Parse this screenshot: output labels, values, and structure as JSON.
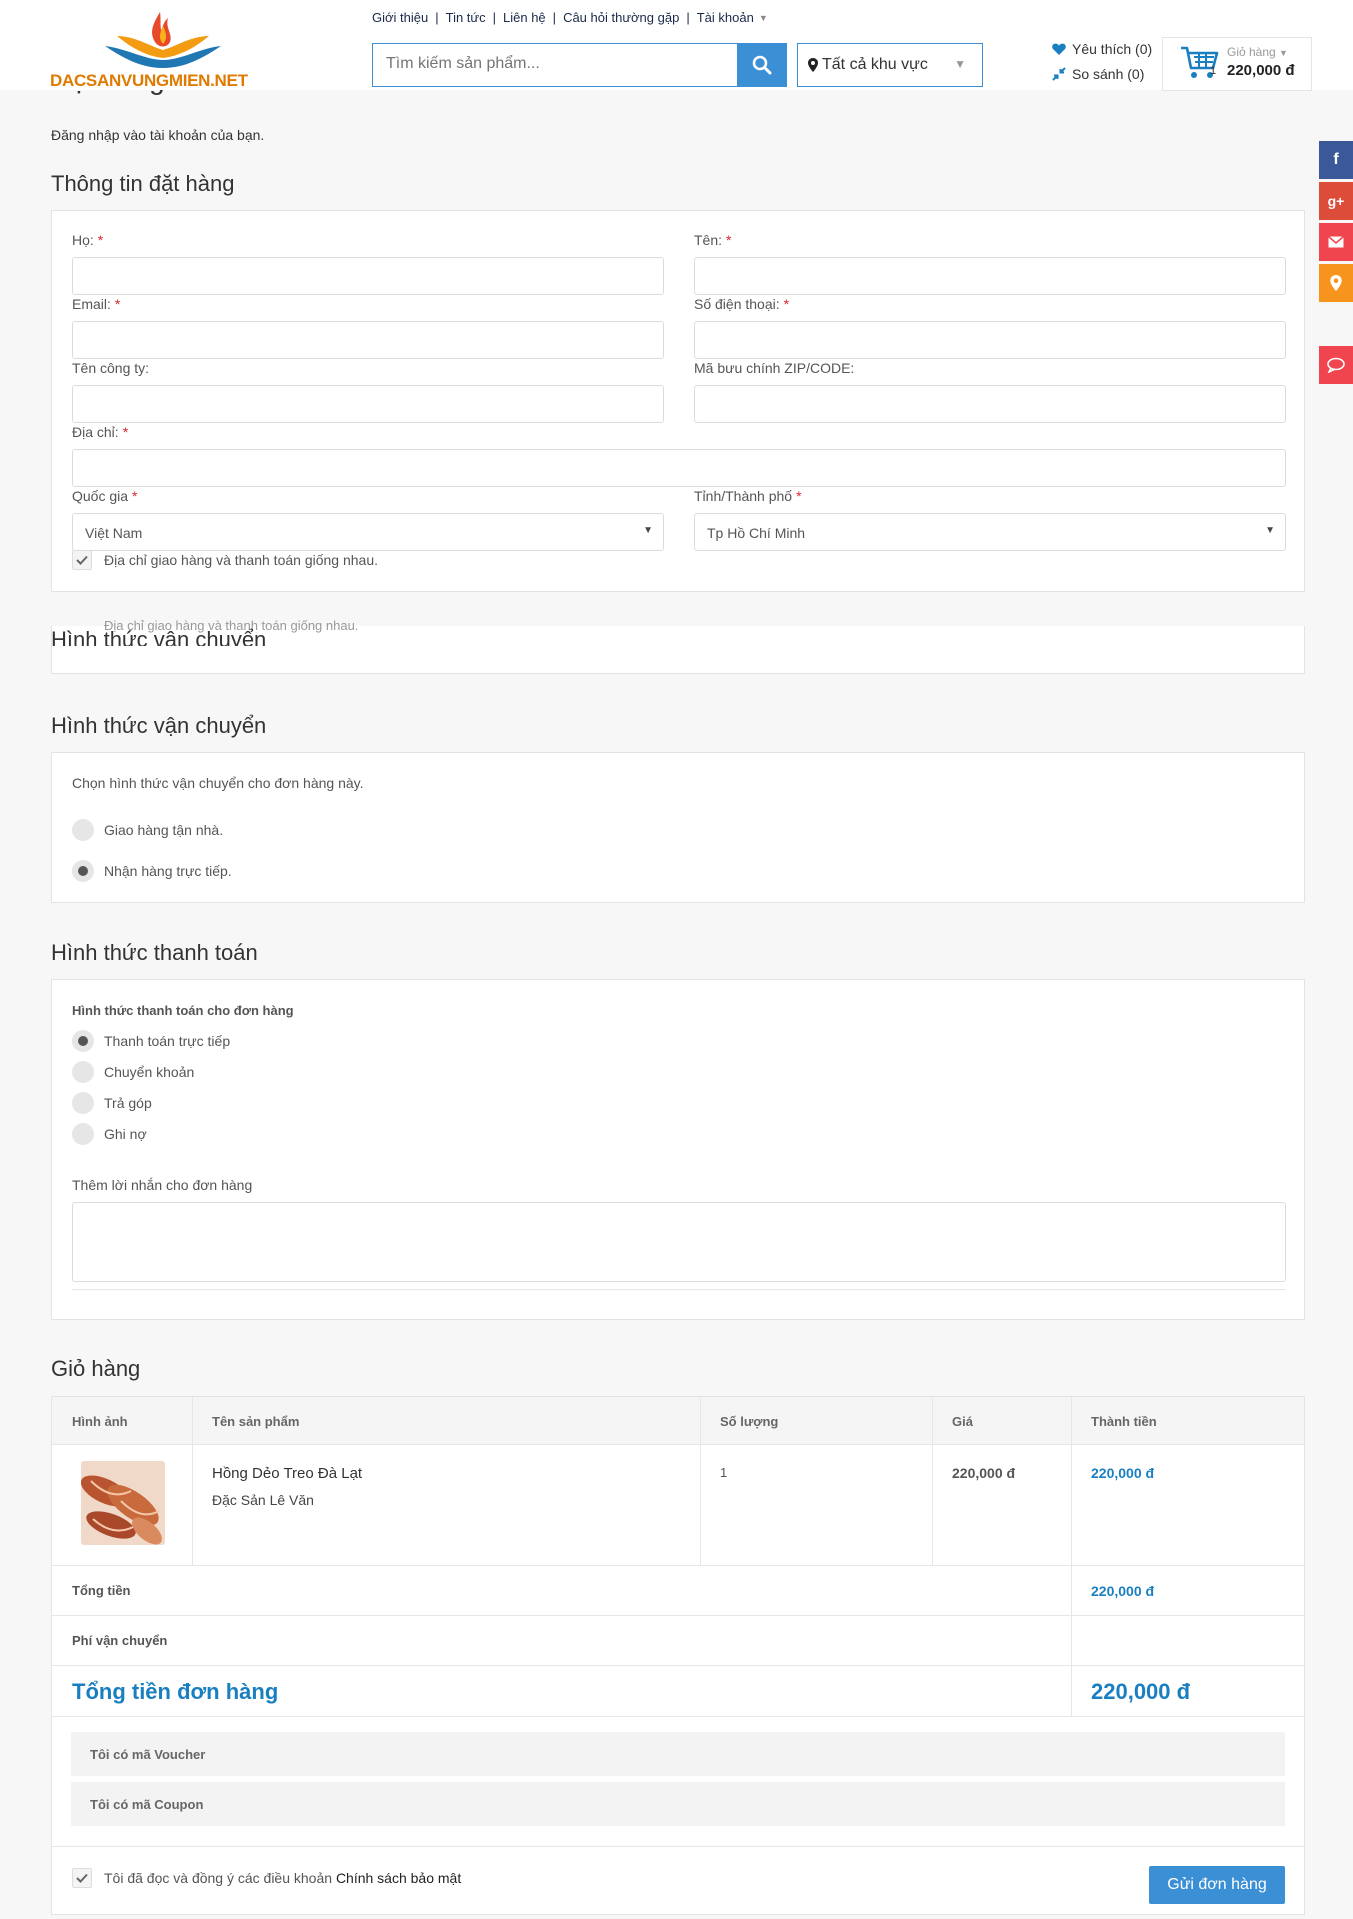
{
  "header": {
    "logo_text": "DACSANVUNGMIEN.NET",
    "top_links": [
      "Giới thiệu",
      "Tin tức",
      "Liên hệ",
      "Câu hỏi thường gặp",
      "Tài khoản"
    ],
    "search_placeholder": "Tìm kiếm sản phẩm...",
    "region": "Tất cả khu vực",
    "wishlist": "Yêu thích (0)",
    "compare": "So sánh (0)",
    "cart_label": "Giỏ hàng",
    "cart_count": "1",
    "cart_total": "220,000 đ"
  },
  "page": {
    "title": "Đặt hàng",
    "login_note": "Đăng nhập vào tài khoản của bạn."
  },
  "order_info": {
    "title": "Thông tin đặt hàng",
    "last_name_label": "Họ:",
    "first_name_label": "Tên:",
    "email_label": "Email:",
    "phone_label": "Số điện thoại:",
    "company_label": "Tên công ty:",
    "zip_label": "Mã bưu chính ZIP/CODE:",
    "address_label": "Địa chỉ:",
    "country_label": "Quốc gia",
    "country_value": "Việt Nam",
    "city_label": "Tỉnh/Thành phố",
    "city_value": "Tp Hồ Chí Minh",
    "same_address": "Địa chỉ giao hàng và thanh toán giống nhau.",
    "required_mark": "*"
  },
  "ghost": {
    "title": "Hình thức vận chuyển",
    "text": "Địa chỉ giao hàng và thanh toán giống nhau."
  },
  "shipping": {
    "title": "Hình thức vận chuyển",
    "note": "Chọn hình thức vận chuyển cho đơn hàng này.",
    "options": [
      "Giao hàng tận nhà.",
      "Nhận hàng trực tiếp."
    ],
    "selected": 1
  },
  "payment": {
    "title": "Hình thức thanh toán",
    "subtitle": "Hình thức thanh toán cho đơn hàng",
    "options": [
      "Thanh toán trực tiếp",
      "Chuyển khoản",
      "Trả góp",
      "Ghi nợ"
    ],
    "selected": 0,
    "message_label": "Thêm lời nhắn cho đơn hàng"
  },
  "cart": {
    "title": "Giỏ hàng",
    "headers": [
      "Hình ảnh",
      "Tên sản phẩm",
      "Số lượng",
      "Giá",
      "Thành tiền"
    ],
    "item": {
      "name": "Hồng Dẻo Treo Đà Lạt",
      "shop": "Đặc Sản Lê Văn",
      "qty": "1",
      "price": "220,000 đ",
      "total": "220,000 đ"
    },
    "subtotal_label": "Tổng tiền",
    "subtotal": "220,000 đ",
    "shipping_label": "Phí vận chuyển",
    "shipping_value": "",
    "grand_label": "Tổng tiền đơn hàng",
    "grand_total": "220,000 đ",
    "voucher": "Tôi có mã Voucher",
    "coupon": "Tôi có mã Coupon",
    "terms_prefix": "Tôi đã đọc và đồng ý các điều khoản",
    "terms_link": "Chính sách bảo mật",
    "submit": "Gửi đơn hàng"
  },
  "colors": {
    "accent": "#3b8fd4",
    "price_blue": "#1a7fc1",
    "facebook": "#3b5998",
    "google": "#dd4b39",
    "mail": "#f0444e",
    "map": "#f7941d",
    "chat": "#f0444e"
  },
  "social_icons": [
    "facebook-icon",
    "google-plus-icon",
    "mail-icon",
    "map-pin-icon",
    "chat-icon"
  ]
}
